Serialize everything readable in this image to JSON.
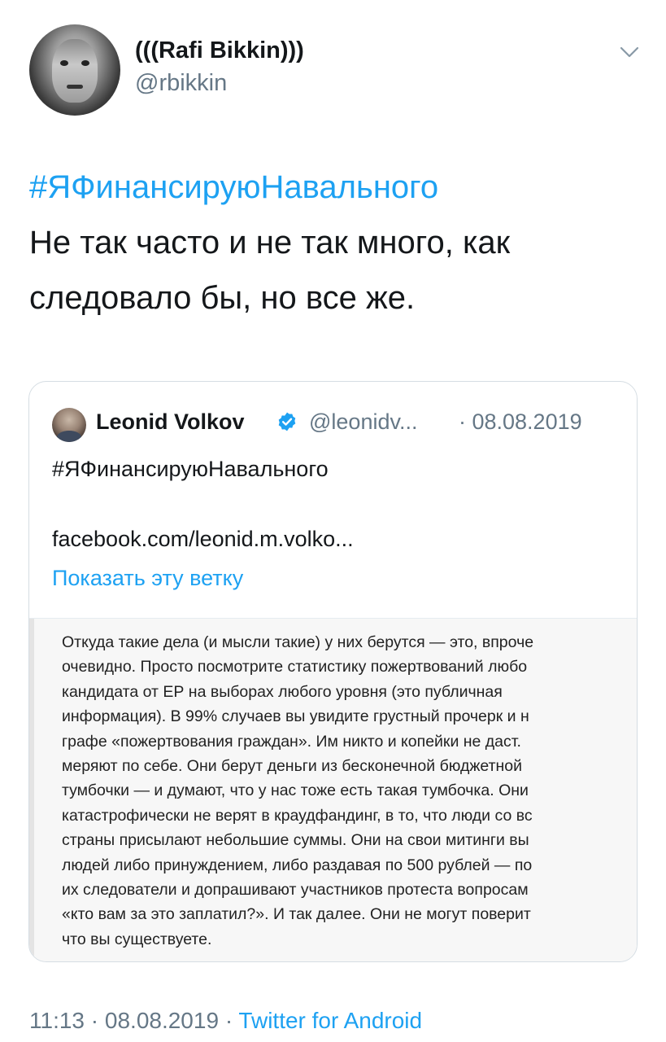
{
  "tweet": {
    "author": {
      "display_name": "(((Rafi Bikkin)))",
      "handle": "@rbikkin",
      "avatar_icon": "avatar-photo"
    },
    "menu_icon": "chevron-down-icon",
    "hashtag": "#ЯФинансируюНавального",
    "text_line1": "Не так часто и не так много, как",
    "text_line2": "следовало бы, но все же.",
    "time": "11:13",
    "separator": "·",
    "date": "08.08.2019",
    "source": "Twitter for Android"
  },
  "quoted_tweet": {
    "author_name": "Leonid Volkov",
    "verified_icon": "verified-badge-icon",
    "handle": "@leonidv...",
    "date": "· 08.08.2019",
    "hashtag": "#ЯФинансируюНавального",
    "link": "facebook.com/leonid.m.volko...",
    "show_thread": "Показать эту ветку",
    "image_text": [
      "Откуда такие дела (и мысли такие) у них берутся — это, впроче",
      "очевидно. Просто посмотрите статистику пожертвований любо",
      "кандидата от ЕР на выборах любого уровня (это публичная",
      "информация). В 99% случаев вы увидите грустный прочерк и н",
      "графе «пожертвования граждан». Им никто и копейки не даст.",
      "меряют по себе. Они берут деньги из бесконечной бюджетной",
      "тумбочки — и думают, что у нас тоже есть такая тумбочка. Они",
      "катастрофически не верят в краудфандинг, в то, что люди со вс",
      "страны присылают небольшие суммы. Они на свои митинги вы",
      "людей либо принуждением, либо раздавая по 500 рублей — по",
      "их следователи и допрашивают участников протеста вопросам",
      "«кто вам за это заплатил?». И так далее. Они не могут поверит",
      "что вы существуете."
    ]
  },
  "colors": {
    "link": "#1da1f2",
    "secondary": "#657786",
    "text": "#14171a",
    "border": "#d5dde3"
  }
}
